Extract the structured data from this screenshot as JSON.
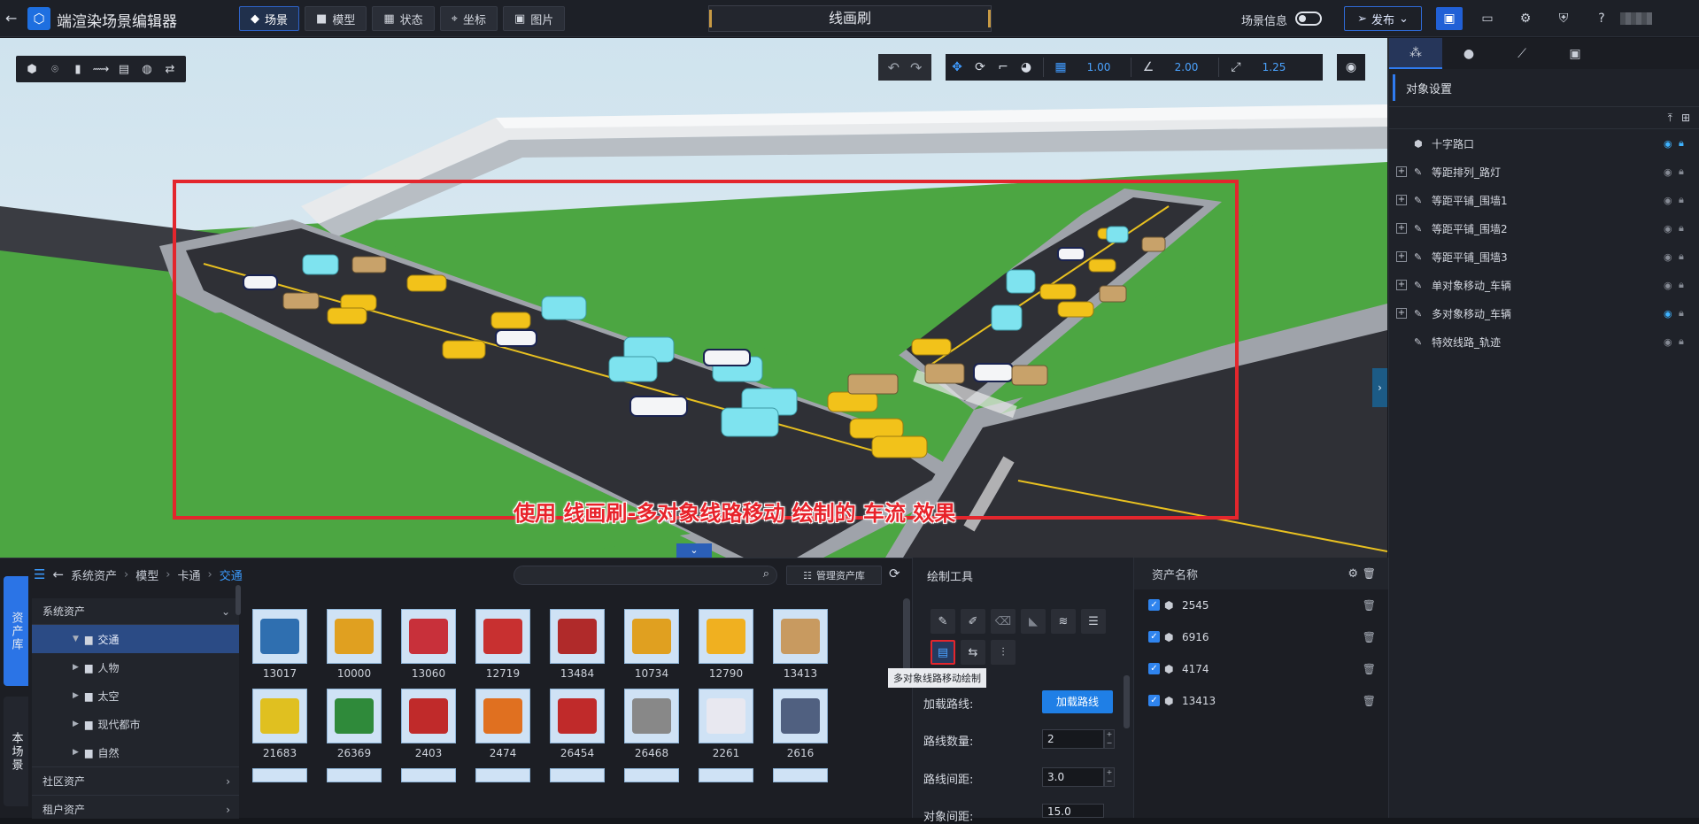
{
  "app": {
    "title": "端渲染场景编辑器",
    "center_title": "线画刷",
    "scene_info": "场景信息",
    "publish": "发布",
    "nav": [
      {
        "label": "场景",
        "icon": "layers-icon",
        "active": true
      },
      {
        "label": "模型",
        "icon": "cube-icon",
        "active": false
      },
      {
        "label": "状态",
        "icon": "grid-icon",
        "active": false
      },
      {
        "label": "坐标",
        "icon": "coordinate-icon",
        "active": false
      },
      {
        "label": "图片",
        "icon": "image-icon",
        "active": false
      }
    ]
  },
  "viewport": {
    "snap_grid": "1.00",
    "snap_angle": "2.00",
    "snap_scale": "1.25",
    "caption": "使用 线画刷-多对象线路移动 绘制的 车流 效果",
    "highlight_color": "#e3262d"
  },
  "right_panel": {
    "section_title": "对象设置",
    "tree": [
      {
        "label": "十字路口",
        "expandable": false,
        "visible_on": true,
        "lock_on": true
      },
      {
        "label": "等距排列_路灯",
        "expandable": true,
        "visible_on": false,
        "lock_on": false
      },
      {
        "label": "等距平铺_围墙1",
        "expandable": true,
        "visible_on": false,
        "lock_on": false
      },
      {
        "label": "等距平铺_围墙2",
        "expandable": true,
        "visible_on": false,
        "lock_on": false
      },
      {
        "label": "等距平铺_围墙3",
        "expandable": true,
        "visible_on": false,
        "lock_on": false
      },
      {
        "label": "单对象移动_车辆",
        "expandable": true,
        "visible_on": false,
        "lock_on": false
      },
      {
        "label": "多对象移动_车辆",
        "expandable": true,
        "visible_on": true,
        "lock_on": false
      },
      {
        "label": "特效线路_轨迹",
        "expandable": false,
        "visible_on": false,
        "lock_on": false
      }
    ]
  },
  "asset_library": {
    "tabs": [
      "资产库",
      "本场景"
    ],
    "breadcrumb": [
      "系统资产",
      "模型",
      "卡通",
      "交通"
    ],
    "manage_label": "管理资产库",
    "tree_header": "系统资产",
    "tree_items": [
      {
        "label": "交通",
        "selected": true
      },
      {
        "label": "人物",
        "selected": false
      },
      {
        "label": "太空",
        "selected": false
      },
      {
        "label": "现代都市",
        "selected": false
      },
      {
        "label": "自然",
        "selected": false
      }
    ],
    "sections": [
      "社区资产",
      "租户资产"
    ],
    "items_row1": [
      "13017",
      "10000",
      "13060",
      "12719",
      "13484",
      "10734",
      "12790",
      "13413"
    ],
    "items_row2": [
      "21683",
      "26369",
      "2403",
      "2474",
      "26454",
      "26468",
      "2261",
      "2616"
    ],
    "thumb_colors_row1": [
      "#2f6fb0",
      "#e0a020",
      "#c8303a",
      "#c83030",
      "#b02a2a",
      "#e0a020",
      "#f0b020",
      "#c89a60"
    ],
    "thumb_colors_row2": [
      "#e0c020",
      "#2f8a3a",
      "#c02a2a",
      "#e07020",
      "#c02a2a",
      "#888888",
      "#e8e8f0",
      "#506080"
    ]
  },
  "draw_tools": {
    "title": "绘制工具",
    "tooltip": "多对象线路移动绘制",
    "load_label": "加载路线:",
    "load_button": "加载路线",
    "route_count_label": "路线数量:",
    "route_count": "2",
    "route_spacing_label": "路线间距:",
    "route_spacing": "3.0",
    "object_spacing_label": "对象间距:",
    "object_spacing": "15.0"
  },
  "asset_list": {
    "header": "资产名称",
    "rows": [
      "2545",
      "6916",
      "4174",
      "13413"
    ]
  }
}
